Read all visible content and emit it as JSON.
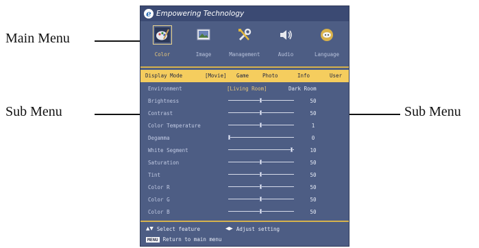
{
  "callouts": {
    "main_menu": "Main Menu",
    "sub_menu_left": "Sub Menu",
    "sub_menu_right": "Sub Menu"
  },
  "osd": {
    "brand": "Empowering Technology",
    "brand_logo": "e",
    "tabs": [
      {
        "label": "Color",
        "icon": "color-palette-icon",
        "active": true
      },
      {
        "label": "Image",
        "icon": "image-icon",
        "active": false
      },
      {
        "label": "Management",
        "icon": "wrench-screwdriver-icon",
        "active": false
      },
      {
        "label": "Audio",
        "icon": "speaker-icon",
        "active": false
      },
      {
        "label": "Language",
        "icon": "language-icon",
        "active": false
      }
    ],
    "display_mode": {
      "label": "Display Mode",
      "options": [
        "[Movie]",
        "Game",
        "Photo",
        "Info",
        "User"
      ],
      "selected": "[Movie]"
    },
    "environment": {
      "label": "Environment",
      "options": [
        "[Living Room]",
        "Dark Room"
      ],
      "selected": "[Living Room]"
    },
    "settings": [
      {
        "label": "Brightness",
        "value": "50",
        "level": 0.5
      },
      {
        "label": "Contrast",
        "value": "50",
        "level": 0.5
      },
      {
        "label": "Color Temperature",
        "value": "1",
        "level": 0.5
      },
      {
        "label": "Degamma",
        "value": "0",
        "level": 0.0
      },
      {
        "label": "White Segment",
        "value": "10",
        "level": 1.0
      },
      {
        "label": "Saturation",
        "value": "50",
        "level": 0.5
      },
      {
        "label": "Tint",
        "value": "50",
        "level": 0.5
      },
      {
        "label": "Color R",
        "value": "50",
        "level": 0.5
      },
      {
        "label": "Color G",
        "value": "50",
        "level": 0.5
      },
      {
        "label": "Color B",
        "value": "50",
        "level": 0.5
      }
    ],
    "footer": {
      "select": "Select feature",
      "adjust": "Adjust setting",
      "menu_key": "MENU",
      "return": "Return to main menu"
    }
  },
  "colors": {
    "panel": "#4d5d84",
    "header": "#3b4a73",
    "highlight": "#f5cd5e",
    "rule": "#d7b34c"
  }
}
